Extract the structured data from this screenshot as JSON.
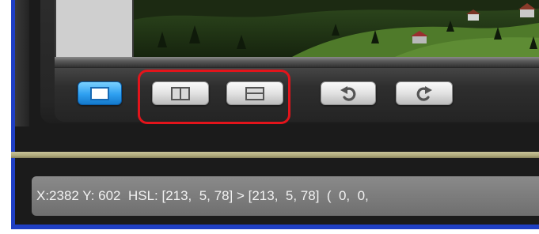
{
  "toolbar": {
    "buttons": [
      {
        "name": "single-view-button",
        "icon": "single-pane-icon",
        "active": true
      },
      {
        "name": "split-vertical-button",
        "icon": "split-vertical-icon",
        "active": false
      },
      {
        "name": "split-horizontal-button",
        "icon": "split-horizontal-icon",
        "active": false
      },
      {
        "name": "rotate-left-button",
        "icon": "rotate-left-icon",
        "glyph": "↶",
        "active": false
      },
      {
        "name": "rotate-right-button",
        "icon": "rotate-right-icon",
        "glyph": "↷",
        "active": false
      }
    ],
    "highlight_color": "#e3141b"
  },
  "status": {
    "text": "X:2382 Y: 602  HSL: [213,  5, 78] > [213,  5, 78]  (  0,  0,"
  },
  "colors": {
    "frame_border": "#1f3fc4",
    "active_button": "#2e9ff0",
    "seek_track": "#b0aa7c"
  }
}
